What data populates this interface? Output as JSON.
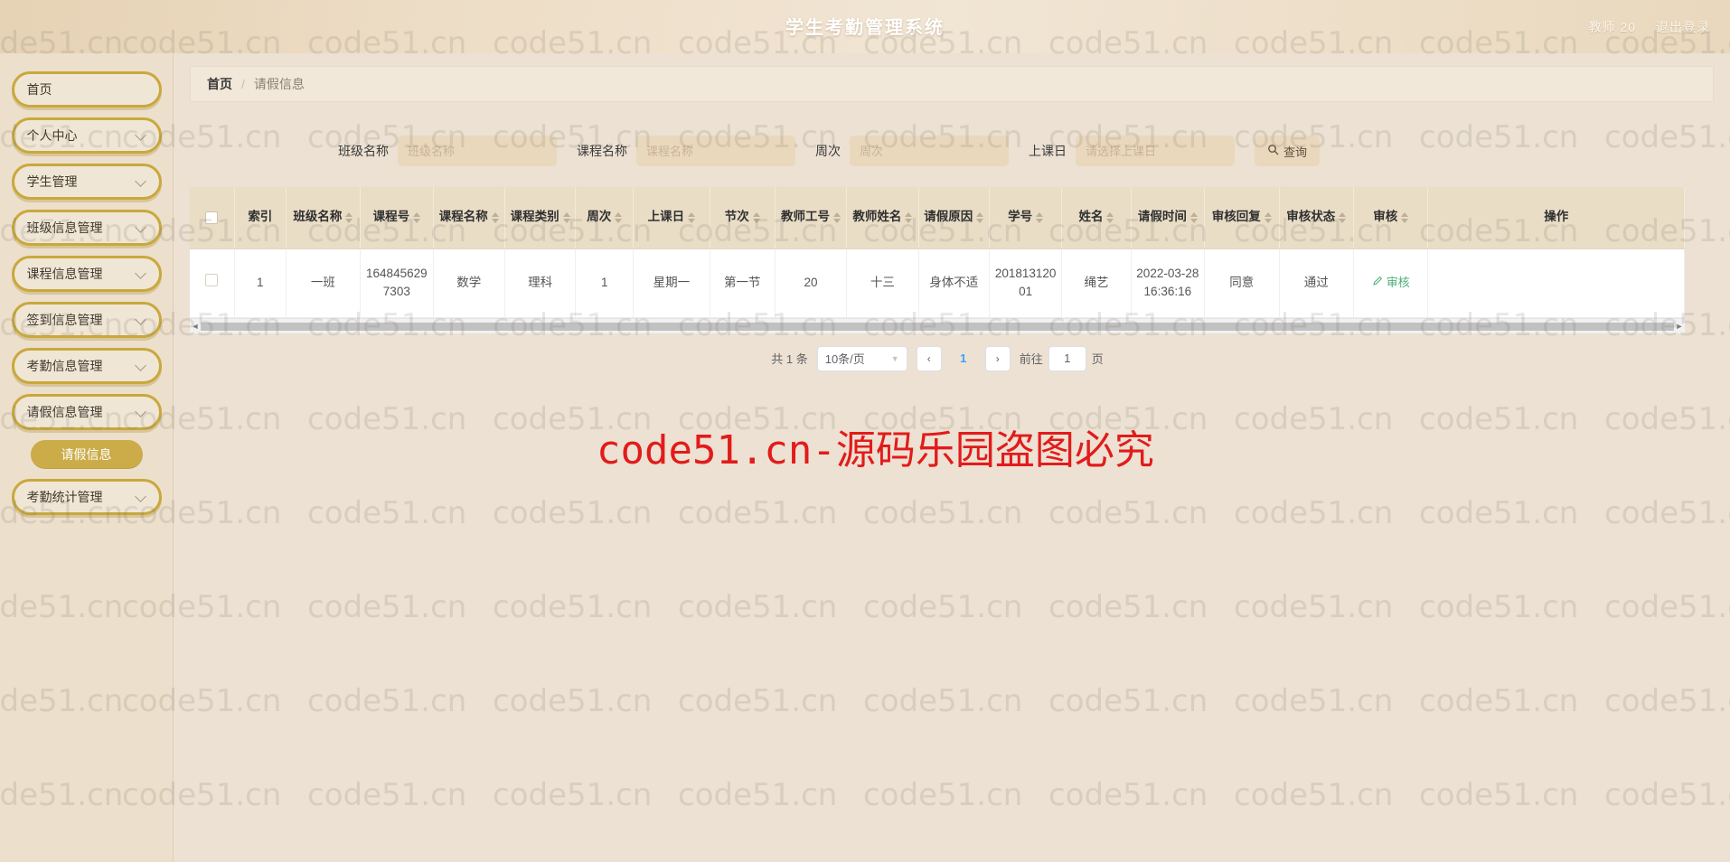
{
  "app": {
    "title": "学生考勤管理系统",
    "user_label": "教师 20",
    "logout_label": "退出登录",
    "accent_gold": "#c9a83c",
    "header_bg": "#ecdcc3",
    "body_bg": "#ece1d2"
  },
  "sidebar": {
    "items": [
      {
        "label": "首页",
        "has_chevron": false
      },
      {
        "label": "个人中心",
        "has_chevron": true
      },
      {
        "label": "学生管理",
        "has_chevron": true
      },
      {
        "label": "班级信息管理",
        "has_chevron": true
      },
      {
        "label": "课程信息管理",
        "has_chevron": true
      },
      {
        "label": "签到信息管理",
        "has_chevron": true
      },
      {
        "label": "考勤信息管理",
        "has_chevron": true
      },
      {
        "label": "请假信息管理",
        "has_chevron": true
      }
    ],
    "active_sub": {
      "label": "请假信息"
    },
    "items_after": [
      {
        "label": "考勤统计管理",
        "has_chevron": true
      }
    ]
  },
  "breadcrumb": {
    "home": "首页",
    "separator": "/",
    "current": "请假信息"
  },
  "search": {
    "fields": [
      {
        "label": "班级名称",
        "placeholder": "班级名称",
        "value": ""
      },
      {
        "label": "课程名称",
        "placeholder": "课程名称",
        "value": ""
      },
      {
        "label": "周次",
        "placeholder": "周次",
        "value": ""
      },
      {
        "label": "上课日",
        "placeholder": "请选择上课日",
        "value": ""
      }
    ],
    "button_label": "查询",
    "button_icon": "search-icon"
  },
  "table": {
    "headers": [
      {
        "label": "索引",
        "sortable": false
      },
      {
        "label": "班级名称",
        "sortable": true
      },
      {
        "label": "课程号",
        "sortable": true
      },
      {
        "label": "课程名称",
        "sortable": true
      },
      {
        "label": "课程类别",
        "sortable": true
      },
      {
        "label": "周次",
        "sortable": true
      },
      {
        "label": "上课日",
        "sortable": true
      },
      {
        "label": "节次",
        "sortable": true
      },
      {
        "label": "教师工号",
        "sortable": true
      },
      {
        "label": "教师姓名",
        "sortable": true
      },
      {
        "label": "请假原因",
        "sortable": true
      },
      {
        "label": "学号",
        "sortable": true
      },
      {
        "label": "姓名",
        "sortable": true
      },
      {
        "label": "请假时间",
        "sortable": true
      },
      {
        "label": "审核回复",
        "sortable": true
      },
      {
        "label": "审核状态",
        "sortable": true
      },
      {
        "label": "审核",
        "sortable": true
      },
      {
        "label": "操作",
        "sortable": false
      }
    ],
    "rows": [
      {
        "index": "1",
        "class_name": "一班",
        "course_no": "1648456297303",
        "course_name": "数学",
        "course_type": "理科",
        "week": "1",
        "class_day": "星期一",
        "period": "第一节",
        "teacher_no": "20",
        "teacher_name": "十三",
        "leave_reason": "身体不适",
        "student_no": "20181312001",
        "student_name": "绳艺",
        "leave_time": "2022-03-28 16:36:16",
        "audit_reply": "同意",
        "audit_status": "通过",
        "audit_action": "审核",
        "audit_action_icon": "pencil-icon",
        "operation": ""
      }
    ]
  },
  "pagination": {
    "total_label": "共 1 条",
    "page_size_label": "10条/页",
    "current_page": "1",
    "prev_label": "‹",
    "next_label": "›",
    "jump_prefix": "前往",
    "jump_value": "1",
    "jump_suffix": "页"
  },
  "watermarks": {
    "tile_text": "code51.cn",
    "red_text": "code51.cn-源码乐园盗图必究",
    "red_color": "#e21b1b"
  }
}
